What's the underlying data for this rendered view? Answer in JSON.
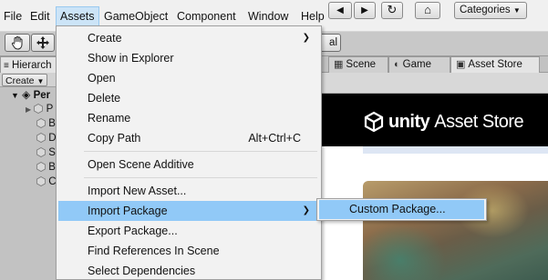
{
  "menubar": {
    "items": [
      "File",
      "Edit",
      "Assets",
      "GameObject",
      "Component",
      "Window",
      "Help"
    ]
  },
  "toolbar": {
    "pivot_label": "al"
  },
  "hierarchy": {
    "tab_label": "Hierarch",
    "create_label": "Create",
    "root_label": "Per",
    "children": [
      "P",
      "B",
      "D",
      "S",
      "B",
      "C"
    ]
  },
  "scene_tabs": {
    "scene": "Scene",
    "game": "Game",
    "asset_store": "Asset Store"
  },
  "browser": {
    "categories_label": "Categories"
  },
  "store": {
    "logo_bold": "unity",
    "logo_light": "Asset Store"
  },
  "assets_menu": {
    "items": [
      {
        "label": "Create",
        "shortcut": "",
        "submenu": true
      },
      {
        "label": "Show in Explorer",
        "shortcut": "",
        "submenu": false
      },
      {
        "label": "Open",
        "shortcut": "",
        "submenu": false
      },
      {
        "label": "Delete",
        "shortcut": "",
        "submenu": false
      },
      {
        "label": "Rename",
        "shortcut": "",
        "submenu": false
      },
      {
        "label": "Copy Path",
        "shortcut": "Alt+Ctrl+C",
        "submenu": false
      },
      {
        "label": "Open Scene Additive",
        "shortcut": "",
        "submenu": false
      },
      {
        "label": "Import New Asset...",
        "shortcut": "",
        "submenu": false
      },
      {
        "label": "Import Package",
        "shortcut": "",
        "submenu": true
      },
      {
        "label": "Export Package...",
        "shortcut": "",
        "submenu": false
      },
      {
        "label": "Find References In Scene",
        "shortcut": "",
        "submenu": false
      },
      {
        "label": "Select Dependencies",
        "shortcut": "",
        "submenu": false
      }
    ]
  },
  "import_package_submenu": {
    "items": [
      "Custom Package..."
    ]
  },
  "colors": {
    "menu_highlight": "#91c9f7",
    "menubar_active": "#cce4f7",
    "store_header": "#000000"
  }
}
